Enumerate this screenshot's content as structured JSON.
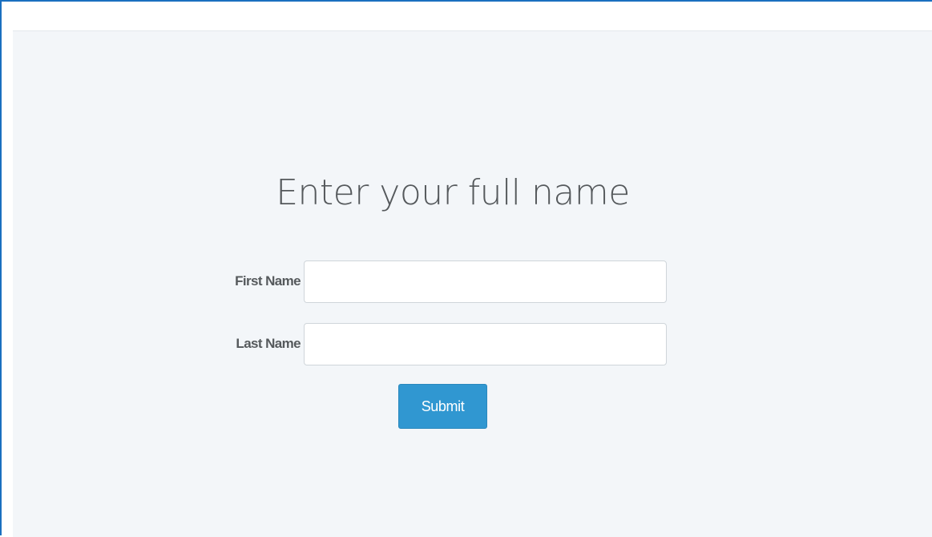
{
  "page": {
    "title": "Enter your full name"
  },
  "form": {
    "first_name_label": "First Name",
    "first_name_value": "",
    "first_name_placeholder": "",
    "last_name_label": "Last Name",
    "last_name_value": "",
    "last_name_placeholder": "",
    "submit_label": "Submit"
  },
  "colors": {
    "accent": "#3097d1",
    "background": "#f3f6f9",
    "text": "#55595c",
    "frame_border": "#1a6fbf"
  }
}
